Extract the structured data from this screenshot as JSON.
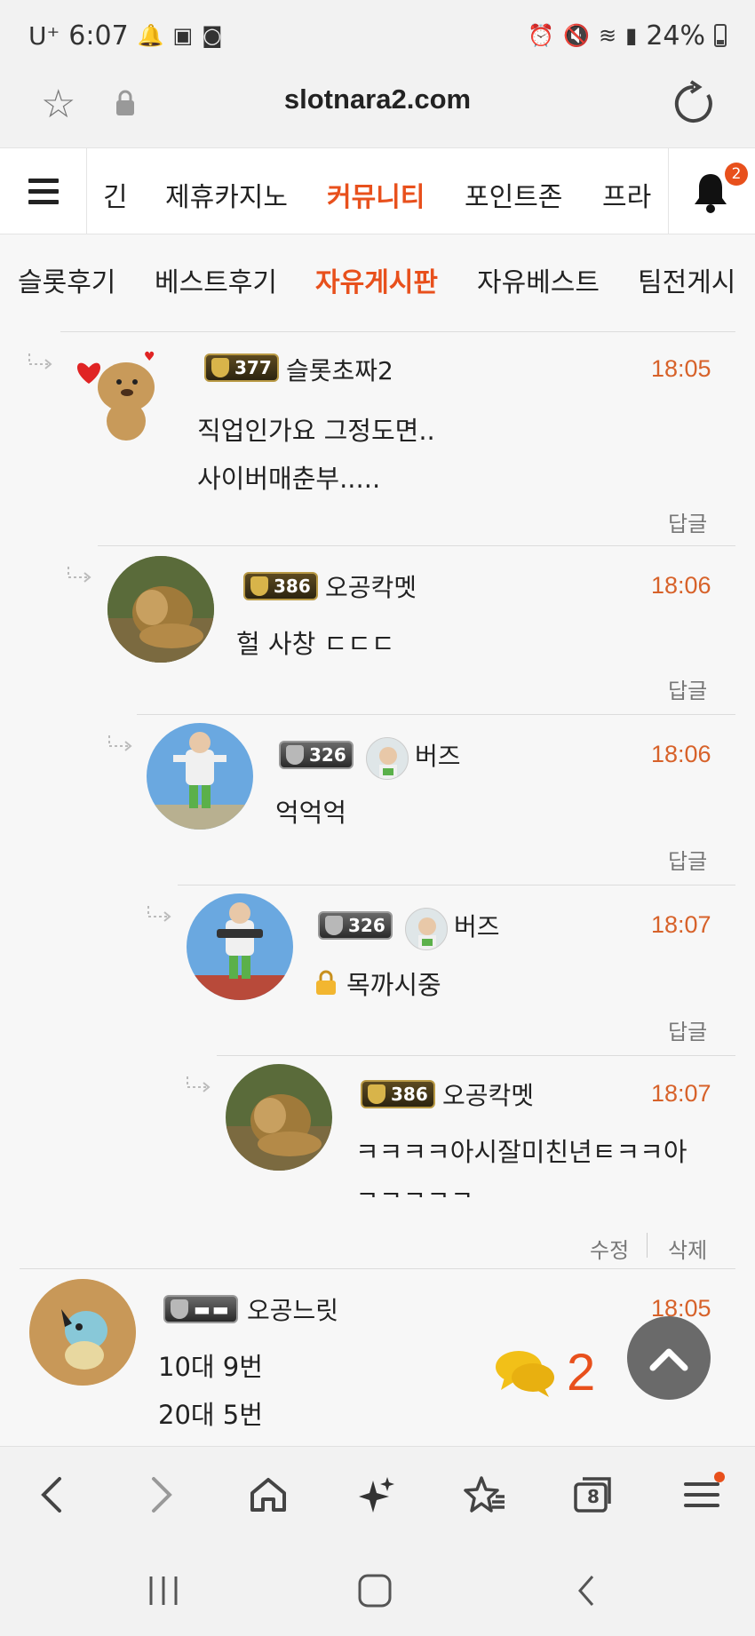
{
  "status_bar": {
    "carrier": "U⁺",
    "time": "6:07",
    "battery": "24%"
  },
  "url_bar": {
    "url": "slotnara2.com"
  },
  "main_nav": {
    "items": [
      "긴",
      "제휴카지노",
      "커뮤니티",
      "포인트존",
      "프라"
    ],
    "active": "커뮤니티",
    "notification_count": "2"
  },
  "sub_nav": {
    "items": [
      "슬롯후기",
      "베스트후기",
      "자유게시판",
      "자유베스트",
      "팀전게시"
    ],
    "active": "자유게시판"
  },
  "comments": [
    {
      "level": "377",
      "nick": "슬롯초짜2",
      "time": "18:05",
      "lines": [
        "직업인가요 그정도면..",
        "사이버매춘부....."
      ],
      "action": "답글",
      "badge": "gold"
    },
    {
      "level": "386",
      "nick": "오공칵멧",
      "time": "18:06",
      "lines": [
        "헐 사창 ㄷㄷㄷ"
      ],
      "action": "답글",
      "badge": "gold"
    },
    {
      "level": "326",
      "nick": "버즈",
      "time": "18:06",
      "lines": [
        "억억억"
      ],
      "action": "답글",
      "badge": "silver"
    },
    {
      "level": "326",
      "nick": "버즈",
      "time": "18:07",
      "lines": [
        "목까시중"
      ],
      "action": "답글",
      "badge": "silver"
    },
    {
      "level": "386",
      "nick": "오공칵멧",
      "time": "18:07",
      "lines": [
        "ㅋㅋㅋㅋ아시잘미친년ㅌㅋㅋ아",
        "ㅋㅋㅋㅋㅋ"
      ],
      "actions": [
        "수정",
        "삭제"
      ],
      "badge": "gold"
    },
    {
      "nick": "오공느릿",
      "time": "18:05",
      "lines": [
        "10대 9번",
        "20대 5번"
      ],
      "badge": "silver"
    }
  ],
  "reply_count": "2",
  "bottom_bar": {
    "tabs_count": "8"
  }
}
